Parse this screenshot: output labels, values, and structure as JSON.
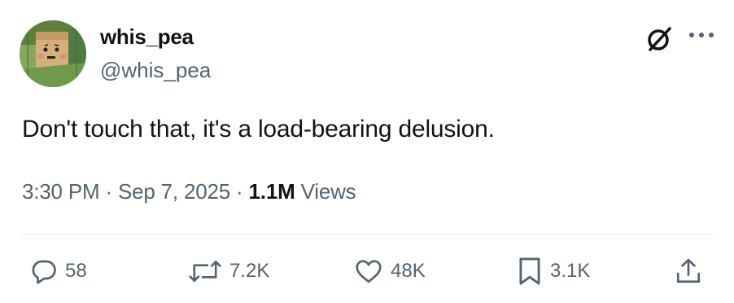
{
  "author": {
    "display_name": "whis_pea",
    "handle": "@whis_pea"
  },
  "icons": {
    "grok": "grok-icon",
    "more": "more-icon",
    "reply": "reply-icon",
    "repost": "repost-icon",
    "like": "heart-icon",
    "bookmark": "bookmark-icon",
    "share": "share-icon"
  },
  "tweet": {
    "text": "Don't touch that, it's a load-bearing delusion.",
    "time": "3:30 PM",
    "separator": "·",
    "date": "Sep 7, 2025",
    "views_count": "1.1M",
    "views_label": "Views"
  },
  "actions": {
    "replies": "58",
    "reposts": "7.2K",
    "likes": "48K",
    "bookmarks": "3.1K"
  },
  "colors": {
    "text": "#0f1419",
    "secondary": "#536471",
    "divider": "#e6ecf0"
  }
}
